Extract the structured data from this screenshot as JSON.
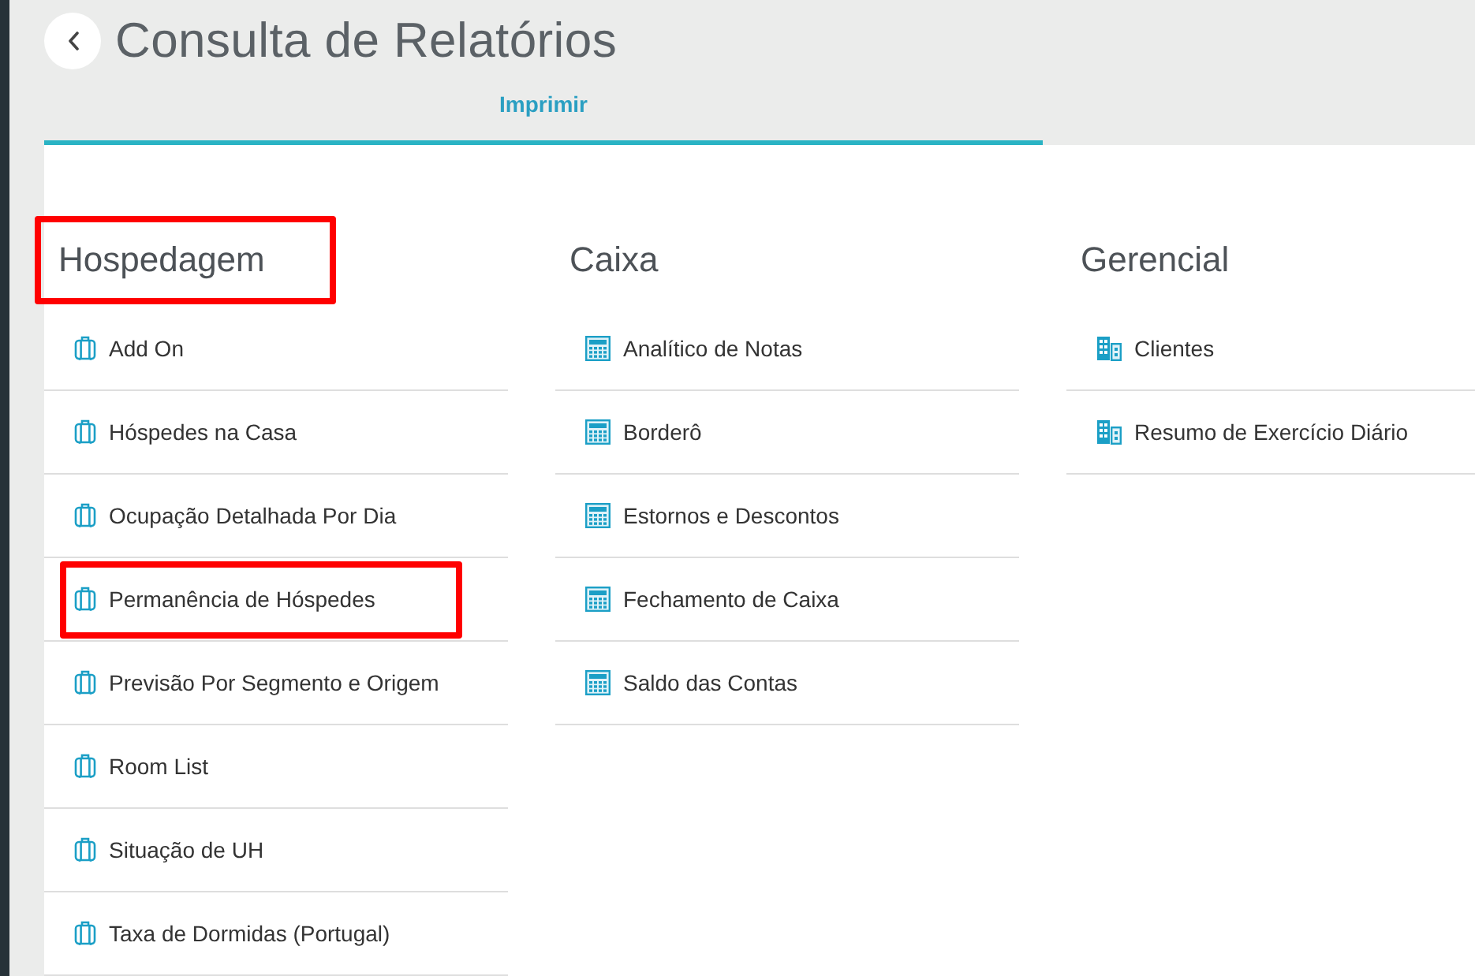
{
  "header": {
    "title": "Consulta de Relatórios"
  },
  "tabs": [
    {
      "label": "Imprimir",
      "selected": true
    }
  ],
  "sections": [
    {
      "title": "Hospedagem",
      "kind": "luggage",
      "highlighted": true,
      "items": [
        {
          "label": "Add On",
          "highlighted": false
        },
        {
          "label": "Hóspedes na Casa",
          "highlighted": false
        },
        {
          "label": "Ocupação Detalhada Por Dia",
          "highlighted": false
        },
        {
          "label": "Permanência de Hóspedes",
          "highlighted": true
        },
        {
          "label": "Previsão Por Segmento e Origem",
          "highlighted": false
        },
        {
          "label": "Room List",
          "highlighted": false
        },
        {
          "label": "Situação de UH",
          "highlighted": false
        },
        {
          "label": "Taxa de Dormidas (Portugal)",
          "highlighted": false
        }
      ]
    },
    {
      "title": "Caixa",
      "kind": "calculator",
      "highlighted": false,
      "items": [
        {
          "label": "Analítico de Notas",
          "highlighted": false
        },
        {
          "label": "Borderô",
          "highlighted": false
        },
        {
          "label": "Estornos e Descontos",
          "highlighted": false
        },
        {
          "label": "Fechamento de Caixa",
          "highlighted": false
        },
        {
          "label": "Saldo das Contas",
          "highlighted": false
        }
      ]
    },
    {
      "title": "Gerencial",
      "kind": "buildings",
      "highlighted": false,
      "items": [
        {
          "label": "Clientes",
          "highlighted": false
        },
        {
          "label": "Resumo de Exercício Diário",
          "highlighted": false
        }
      ]
    }
  ]
}
